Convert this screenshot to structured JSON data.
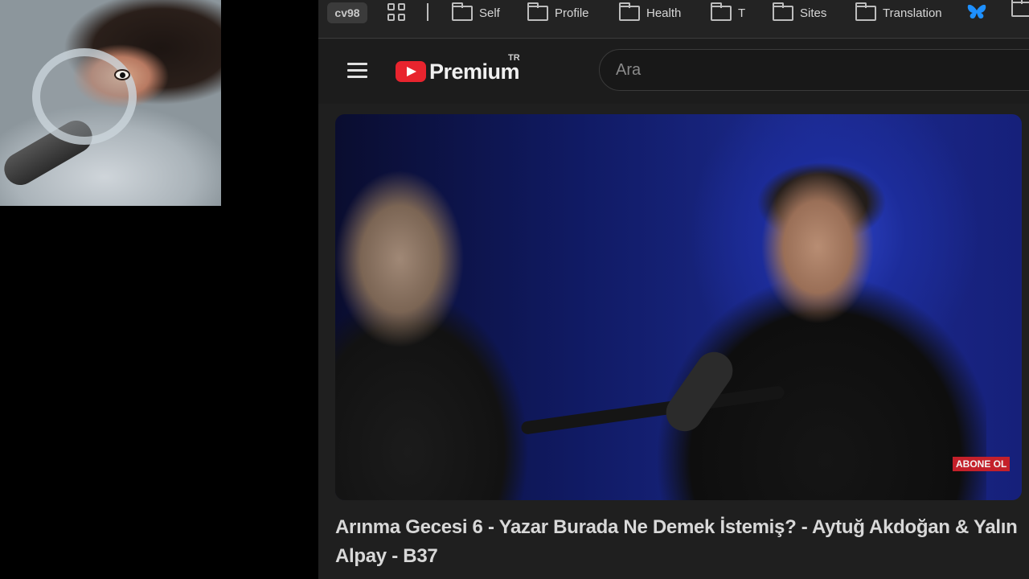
{
  "bookmarks_bar": {
    "profile_label": "cv98",
    "items": [
      {
        "label": "Self",
        "icon": "folder-icon"
      },
      {
        "label": "Profile",
        "icon": "folder-icon"
      },
      {
        "label": "Health",
        "icon": "folder-icon"
      },
      {
        "label": "T",
        "icon": "folder-icon"
      },
      {
        "label": "Sites",
        "icon": "folder-icon"
      },
      {
        "label": "Translation",
        "icon": "folder-icon"
      }
    ],
    "extra_icon": "butterfly-icon"
  },
  "masthead": {
    "logo_text": "Premium",
    "region": "TR",
    "search_placeholder": "Ara"
  },
  "video": {
    "overlay_badge": "ABONE OL",
    "title": "Arınma Gecesi 6 - Yazar Burada Ne Demek İstemiş? - Aytuğ Akdoğan & Yalın Alpay - B37"
  },
  "colors": {
    "youtube_red": "#e8242e",
    "background": "#1f1f1f",
    "badge_red": "#c4202a",
    "butterfly_blue": "#1e90ff"
  }
}
